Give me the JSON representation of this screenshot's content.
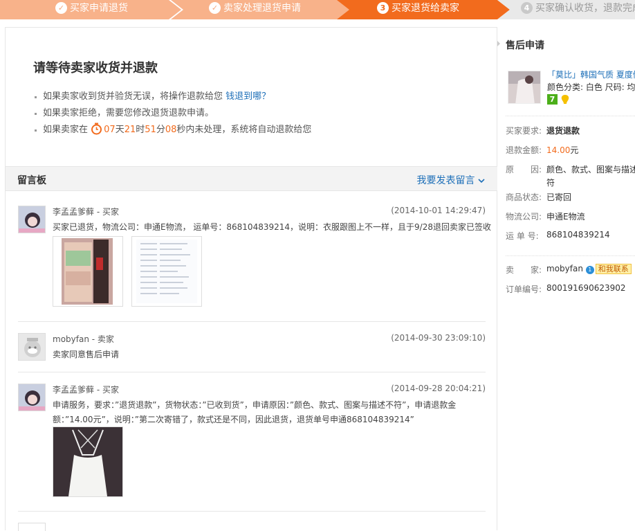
{
  "steps": [
    {
      "label": "买家申请退货",
      "state": "done"
    },
    {
      "label": "卖家处理退货申请",
      "state": "done"
    },
    {
      "num": "3",
      "label": "买家退货给卖家",
      "state": "current"
    },
    {
      "num": "4",
      "label": "买家确认收货，退款完成",
      "state": "next"
    }
  ],
  "colors": {
    "done": "#f8b28a",
    "current": "#f26b1d",
    "next": "#e9e9e9",
    "accent": "#f26b1d",
    "link": "#1d6fb8"
  },
  "status": {
    "title": "请等待卖家收货并退款",
    "tip1": "如果卖家收到货并验货无误，将操作退款给您",
    "tip1_link": "钱退到哪？",
    "tip2": "如果卖家拒绝，需要您修改退货退款申请。",
    "tip3_pre": "如果卖家在",
    "days": "07",
    "days_unit": "天",
    "hours": "21",
    "hours_unit": "时",
    "mins": "51",
    "mins_unit": "分",
    "secs": "08",
    "tip3_post": "秒内未处理，系统将自动退款给您"
  },
  "board": {
    "title": "留言板",
    "post_link": "我要发表留言",
    "messages": [
      {
        "author": "李孟孟爹藓 - 买家",
        "time": "(2014-10-01 14:29:47)",
        "text": "买家已退货，物流公司：申通E物流， 运单号：868104839214，说明：衣服跟图上不一样，且于9/28退回卖家已签收"
      },
      {
        "author": "mobyfan - 卖家",
        "time": "(2014-09-30 23:09:10)",
        "text": "卖家同意售后申请"
      },
      {
        "author": "李孟孟爹藓 - 买家",
        "time": "(2014-09-28 20:04:21)",
        "text": "申请服务，要求：”退货退款”，货物状态：”已收到货”，申请原因：”颜色、款式、图案与描述不符”，申请退款金额：”14.00元”，说明：”第二次寄错了，款式还是不同，因此退货，退货单号申通868104839214”"
      }
    ]
  },
  "side": {
    "title": "售后申请",
    "product_name": "「莫比」韩国气质 夏度假",
    "product_attr": "颜色分类: 白色 尺码: 均码",
    "badge7": "7",
    "req_label": "买家要求:",
    "req_value": "退货退款",
    "amount_label": "退款金额:",
    "amount_value": "14.00",
    "amount_unit": "元",
    "reason_label": "原　　因:",
    "reason_value1": "颜色、款式、图案与描述不",
    "reason_value2": "符",
    "goods_label": "商品状态:",
    "goods_value": "已寄回",
    "logi_label": "物流公司:",
    "logi_value": "申通E物流",
    "waybill_label": "运 单 号:",
    "waybill_value": "868104839214",
    "seller_label": "卖　　家:",
    "seller_value": "mobyfan",
    "qq_badge": "1",
    "contact": "和我联系",
    "order_label": "订单编号:",
    "order_value": "800191690623902"
  }
}
